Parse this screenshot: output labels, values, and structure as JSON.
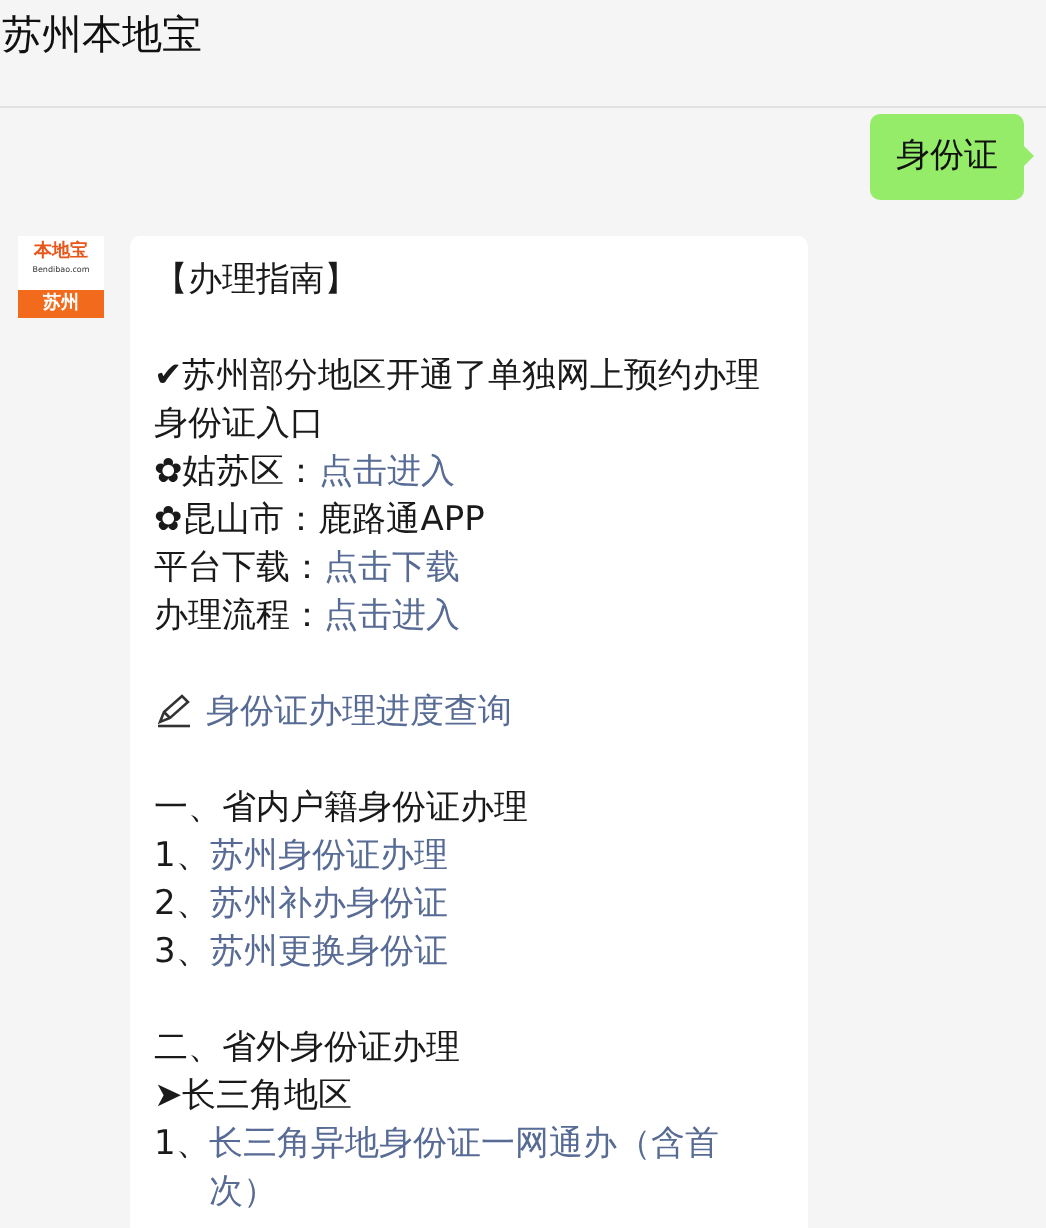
{
  "header": {
    "title": "苏州本地宝"
  },
  "user_message": {
    "text": "身份证"
  },
  "avatar": {
    "brand": "本地宝",
    "domain": "Bendibao.com",
    "city": "苏州"
  },
  "article": {
    "lines": [
      {
        "kind": "text",
        "parts": [
          {
            "text": "【办理指南】",
            "link": false
          }
        ]
      },
      {
        "kind": "gap"
      },
      {
        "kind": "text",
        "parts": [
          {
            "text": "✔苏州部分地区开通了单独网上预约办理身份证入口",
            "link": false
          }
        ]
      },
      {
        "kind": "text",
        "parts": [
          {
            "text": "✿姑苏区：",
            "link": false
          },
          {
            "text": "点击进入",
            "link": true
          }
        ]
      },
      {
        "kind": "text",
        "parts": [
          {
            "text": "✿昆山市：鹿路通APP",
            "link": false
          }
        ]
      },
      {
        "kind": "text",
        "parts": [
          {
            "text": "平台下载：",
            "link": false
          },
          {
            "text": "点击下载",
            "link": true
          }
        ]
      },
      {
        "kind": "text",
        "parts": [
          {
            "text": "办理流程：",
            "link": false
          },
          {
            "text": "点击进入",
            "link": true
          }
        ]
      },
      {
        "kind": "gap"
      },
      {
        "kind": "icon_link",
        "parts": [
          {
            "text": "身份证办理进度查询",
            "link": true
          }
        ]
      },
      {
        "kind": "gap"
      },
      {
        "kind": "text",
        "parts": [
          {
            "text": "一、省内户籍身份证办理",
            "link": false
          }
        ]
      },
      {
        "kind": "text",
        "parts": [
          {
            "text": "1、",
            "link": false
          },
          {
            "text": "苏州身份证办理",
            "link": true
          }
        ]
      },
      {
        "kind": "text",
        "parts": [
          {
            "text": "2、",
            "link": false
          },
          {
            "text": "苏州补办身份证",
            "link": true
          }
        ]
      },
      {
        "kind": "text",
        "parts": [
          {
            "text": "3、",
            "link": false
          },
          {
            "text": "苏州更换身份证",
            "link": true
          }
        ]
      },
      {
        "kind": "gap"
      },
      {
        "kind": "text",
        "parts": [
          {
            "text": "二、省外身份证办理",
            "link": false
          }
        ]
      },
      {
        "kind": "text",
        "parts": [
          {
            "text": "➤长三角地区",
            "link": false
          }
        ]
      },
      {
        "kind": "text",
        "parts": [
          {
            "text": "1、",
            "link": false
          },
          {
            "text": "长三角异地身份证一网通办（含首次）",
            "link": true
          }
        ]
      }
    ]
  }
}
